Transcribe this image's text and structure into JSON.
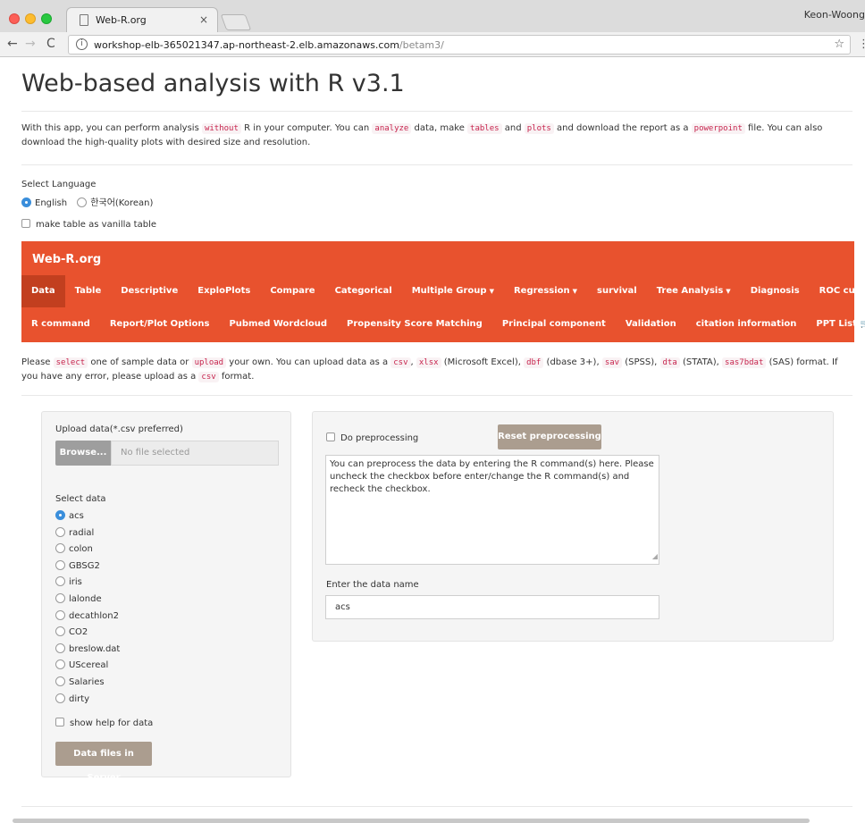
{
  "browser": {
    "tab_title": "Web-R.org",
    "tab_close": "×",
    "user_name": "Keon-Woong",
    "url_host": "workshop-elb-365021347.ap-northeast-2.elb.amazonaws.com",
    "url_path": "/betam3/",
    "info_glyph": "i",
    "star_glyph": "☆",
    "kebab_glyph": "⋮",
    "back_glyph": "←",
    "forward_glyph": "→",
    "reload_glyph": "C"
  },
  "page": {
    "title": "Web-based analysis with R v3.1",
    "intro": {
      "t1": "With this app, you can perform analysis ",
      "c1": "without",
      "t2": " R in your computer. You can ",
      "c2": "analyze",
      "t3": " data, make ",
      "c3": "tables",
      "t4": " and ",
      "c4": "plots",
      "t5": " and download the report as a ",
      "c5": "powerpoint",
      "t6": " file. You can also download the high-quality plots with desired size and resolution."
    },
    "language": {
      "label": "Select Language",
      "options": [
        "English",
        "한국어(Korean)"
      ],
      "selected": "English"
    },
    "vanilla_label": "make table as vanilla table",
    "navbar": {
      "brand": "Web-R.org",
      "row1": [
        "Data",
        "Table",
        "Descriptive",
        "ExploPlots",
        "Compare",
        "Categorical",
        "Multiple Group",
        "Regression",
        "survival",
        "Tree Analysis",
        "Diagnosis",
        "ROC curve"
      ],
      "row2": [
        "R command",
        "Report/Plot Options",
        "Pubmed Wordcloud",
        "Propensity Score Matching",
        "Principal component",
        "Validation",
        "citation information",
        "PPT List"
      ],
      "active": "Data",
      "caret": "▼",
      "cart_glyph": "🛒"
    },
    "prompt": {
      "t1": "Please ",
      "c1": "select",
      "t2": " one of sample data or ",
      "c2": "upload",
      "t3": " your own. You can upload data as a ",
      "c3": "csv",
      "t4": ", ",
      "c4": "xlsx",
      "t5": " (Microsoft Excel), ",
      "c5": "dbf",
      "t6": " (dbase 3+), ",
      "c6": "sav",
      "t7": " (SPSS), ",
      "c7": "dta",
      "t8": " (STATA), ",
      "c8": "sas7bdat",
      "t9": " (SAS) format. If you have any error, please upload as a ",
      "c9": "csv",
      "t10": " format."
    },
    "left_panel": {
      "upload_label": "Upload data(*.csv preferred)",
      "browse_label": "Browse...",
      "file_placeholder": "No file selected",
      "select_label": "Select data",
      "datasets": [
        "acs",
        "radial",
        "colon",
        "GBSG2",
        "iris",
        "lalonde",
        "decathlon2",
        "CO2",
        "breslow.dat",
        "UScereal",
        "Salaries",
        "dirty"
      ],
      "selected_dataset": "acs",
      "show_help_label": "show help for data",
      "data_files_button": "Data files in Server"
    },
    "right_panel": {
      "preprocess_label": "Do preprocessing",
      "reset_button": "Reset preprocessing",
      "textarea_text": "You can preprocess the data by entering the R command(s) here. Please uncheck the checkbox before enter/change the R command(s) and recheck the checkbox.",
      "data_name_label": "Enter the data name",
      "data_name_value": "acs"
    }
  },
  "colors": {
    "navbar": "#e8522e",
    "navbar_active": "#c23f1f",
    "code_text": "#c7254e",
    "radio_on": "#3a8edb",
    "button_gray": "#ab9d8f"
  }
}
